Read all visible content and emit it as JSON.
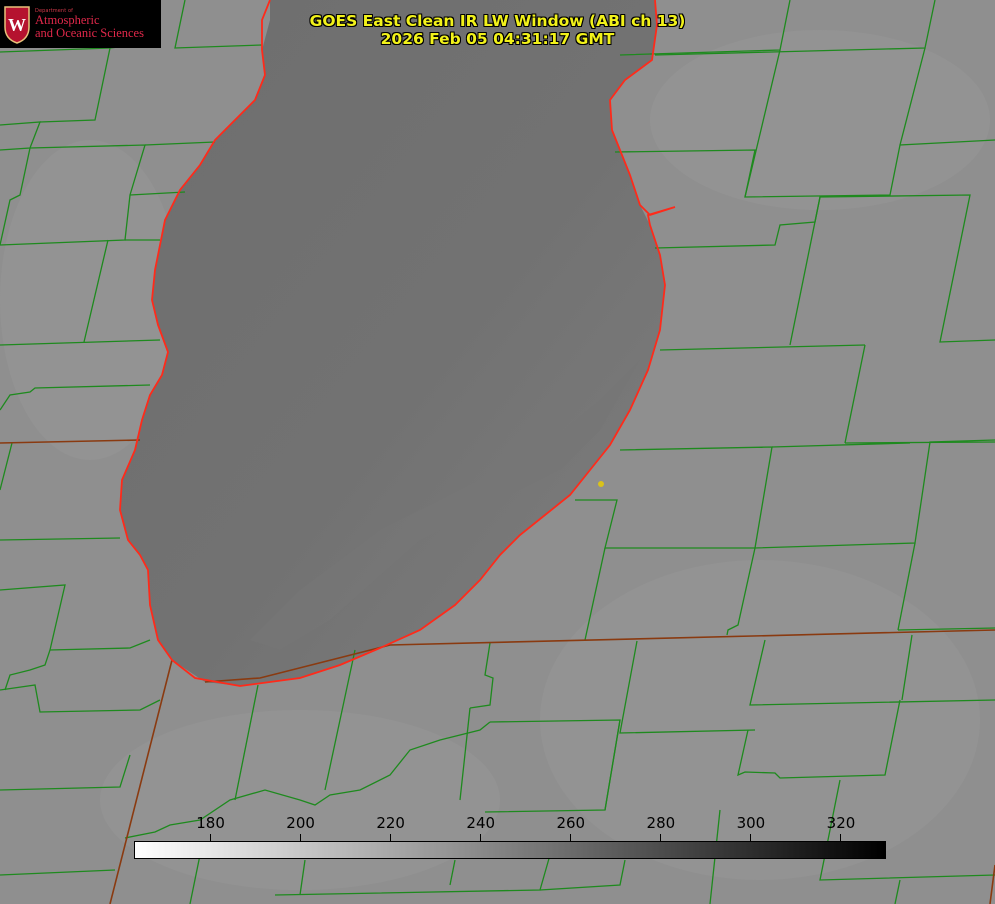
{
  "title": {
    "line1": "GOES East Clean IR LW Window (ABI ch 13)",
    "line2": "2026 Feb 05 04:31:17 GMT"
  },
  "logo": {
    "department": "Department of",
    "line1": "Atmospheric",
    "line2": "and Oceanic Sciences",
    "seal_letter": "W"
  },
  "colorbar": {
    "min": 163,
    "max": 330,
    "ticks": [
      "180",
      "200",
      "220",
      "240",
      "260",
      "280",
      "300",
      "320"
    ],
    "gradient_start": "#ffffff",
    "gradient_end": "#000000"
  },
  "colors": {
    "land": "#8f8f8f",
    "lake": "#6f6f6f",
    "county_border": "#1e8a1e",
    "state_border": "#8a3a10",
    "coastline": "#ff2a1a",
    "marker": "#d9c21a",
    "title_text": "#f2f21a"
  },
  "icons": {
    "seal": "uw-crest-icon",
    "marker": "location-dot-icon"
  }
}
